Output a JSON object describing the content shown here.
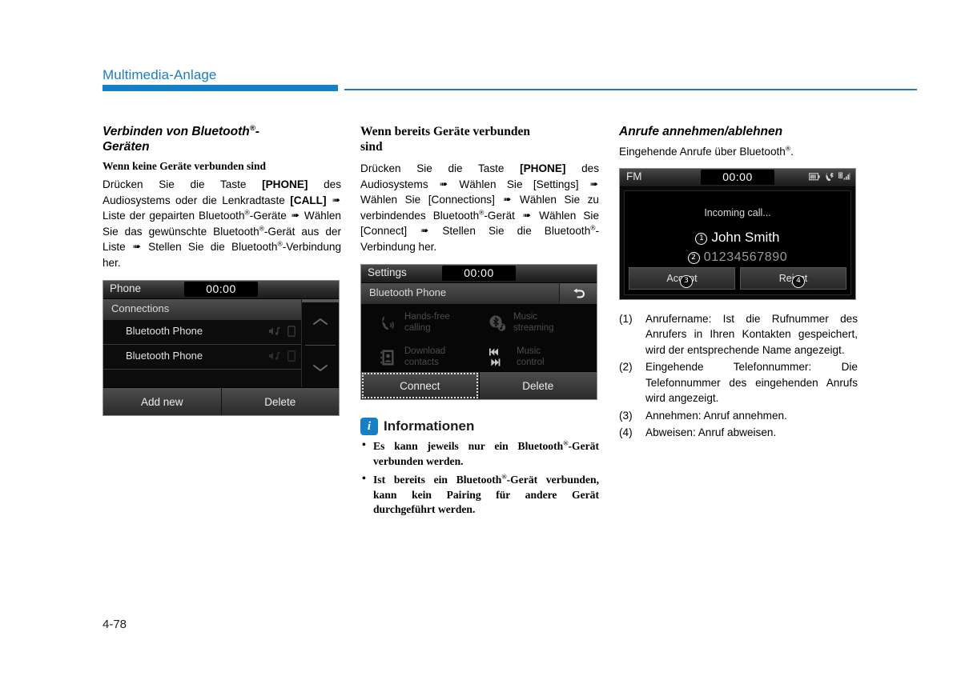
{
  "header": {
    "chapter_title": "Multimedia-Anlage",
    "accent_color": "#1580c4"
  },
  "page_number": "4-78",
  "col1": {
    "heading": "Verbinden von Bluetooth®-Geräten",
    "subheading": "Wenn keine Geräte verbunden sind",
    "paragraph": "Drücken Sie die Taste [PHONE] des Audiosystems oder die Lenkradtaste [CALL] ➠ Liste der gepairten Bluetooth®-Geräte ➠ Wählen Sie das gewünschte Bluetooth®-Gerät aus der Liste ➠ Stellen Sie die Bluetooth®-Verbindung her.",
    "device": {
      "title": "Phone",
      "clock": "00:00",
      "list_title": "Connections",
      "rows": [
        {
          "label": "Bluetooth Phone"
        },
        {
          "label": "Bluetooth Phone"
        },
        {
          "label": ""
        }
      ],
      "buttons": [
        "Add new",
        "Delete"
      ],
      "back_icon": "back-arrow-icon",
      "scroll_up_icon": "chevron-up-icon",
      "scroll_down_icon": "chevron-down-icon"
    }
  },
  "col2": {
    "heading": "Wenn bereits Geräte verbunden sind",
    "paragraph": "Drücken Sie die Taste [PHONE] des Audiosystems ➠ Wählen Sie [Settings] ➠ Wählen Sie [Connections] ➠ Wählen Sie zu verbindendes Bluetooth®-Gerät ➠ Wählen Sie [Connect] ➠ Stellen Sie die Bluetooth®-Verbindung her.",
    "device": {
      "title": "Settings",
      "clock": "00:00",
      "list_title": "Bluetooth Phone",
      "features": [
        {
          "label": "Hands-free calling",
          "icon": "handset-icon"
        },
        {
          "label": "Music streaming",
          "icon": "bluetooth-audio-icon"
        },
        {
          "label": "Download contacts",
          "icon": "contacts-book-icon"
        },
        {
          "label": "Music control",
          "icon": "track-skip-icon"
        }
      ],
      "buttons": [
        "Connect",
        "Delete"
      ],
      "selected_button": "Connect",
      "back_icon": "back-arrow-icon"
    },
    "info": {
      "icon": "info-icon",
      "title": "Informationen",
      "items": [
        "Es kann jeweils nur ein Bluetooth®-Gerät verbunden werden.",
        "Ist bereits ein Bluetooth®-Gerät verbunden, kann kein Pairing für andere Gerät durchgeführt werden."
      ]
    }
  },
  "col3": {
    "heading": "Anrufe annehmen/ablehnen",
    "paragraph": "Eingehende Anrufe über Bluetooth®.",
    "device": {
      "title": "FM",
      "clock": "00:00",
      "status_icons": [
        "battery-icon",
        "bluetooth-phone-icon",
        "signal-strength-icon"
      ],
      "incoming_text": "Incoming call...",
      "caller_name": "John Smith",
      "caller_number": "01234567890",
      "caller_name_marker": "1",
      "caller_number_marker": "2",
      "buttons": [
        {
          "label": "Accept",
          "marker": "3"
        },
        {
          "label": "Reject",
          "marker": "4"
        }
      ]
    },
    "numbered_items": [
      {
        "num": "(1)",
        "text": "Anrufername: Ist die Rufnummer des Anrufers in Ihren Kontakten gespeichert, wird der entsprechende Name angezeigt."
      },
      {
        "num": "(2)",
        "text": "Eingehende Telefonnummer: Die Telefonnummer des eingehenden Anrufs wird angezeigt."
      },
      {
        "num": "(3)",
        "text": "Annehmen: Anruf annehmen."
      },
      {
        "num": "(4)",
        "text": "Abweisen: Anruf abweisen."
      }
    ]
  }
}
